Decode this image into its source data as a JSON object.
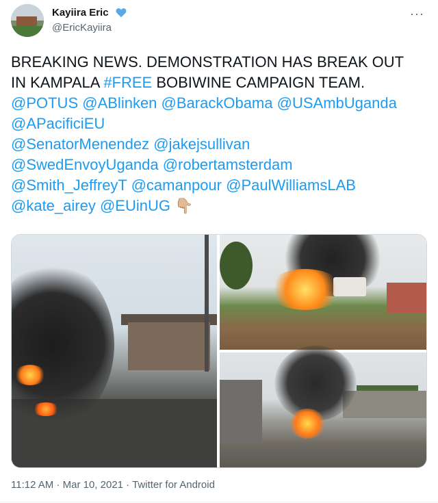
{
  "author": {
    "name": "Kayiira Eric",
    "handle": "@EricKayiira",
    "emoji": "blue-heart"
  },
  "more_label": "···",
  "tweet": {
    "lines": [
      [
        {
          "t": "BREAKING NEWS. DEMONSTRATION HAS BREAK OUT",
          "link": false
        }
      ],
      [
        {
          "t": "IN KAMPALA ",
          "link": false
        },
        {
          "t": "#FREE",
          "link": true
        },
        {
          "t": " BOBIWINE CAMPAIGN TEAM.",
          "link": false
        }
      ],
      [
        {
          "t": "@POTUS",
          "link": true
        },
        {
          "t": " ",
          "link": false
        },
        {
          "t": "@ABlinken",
          "link": true
        },
        {
          "t": " ",
          "link": false
        },
        {
          "t": "@BarackObama",
          "link": true
        },
        {
          "t": " ",
          "link": false
        },
        {
          "t": "@USAmbUganda",
          "link": true
        }
      ],
      [
        {
          "t": "@APacificiEU",
          "link": true
        }
      ],
      [
        {
          "t": "@SenatorMenendez",
          "link": true
        },
        {
          "t": " ",
          "link": false
        },
        {
          "t": "@jakejsullivan",
          "link": true
        }
      ],
      [
        {
          "t": "@SwedEnvoyUganda",
          "link": true
        },
        {
          "t": " ",
          "link": false
        },
        {
          "t": "@robertamsterdam",
          "link": true
        }
      ],
      [
        {
          "t": "@Smith_JeffreyT",
          "link": true
        },
        {
          "t": " ",
          "link": false
        },
        {
          "t": "@camanpour",
          "link": true
        },
        {
          "t": "  ",
          "link": false
        },
        {
          "t": "@PaulWilliamsLAB",
          "link": true
        }
      ],
      [
        {
          "t": "@kate_airey",
          "link": true
        },
        {
          "t": " ",
          "link": false
        },
        {
          "t": "@EUinUG",
          "link": true
        },
        {
          "t": " 👇🏼",
          "link": false
        }
      ]
    ]
  },
  "media": {
    "images": [
      "burning-street-left",
      "burning-vehicle-top-right",
      "fire-in-street-bottom-right"
    ]
  },
  "footer": {
    "time": "11:12 AM",
    "sep1": " · ",
    "date": "Mar 10, 2021",
    "sep2": " · ",
    "source": "Twitter for Android"
  }
}
